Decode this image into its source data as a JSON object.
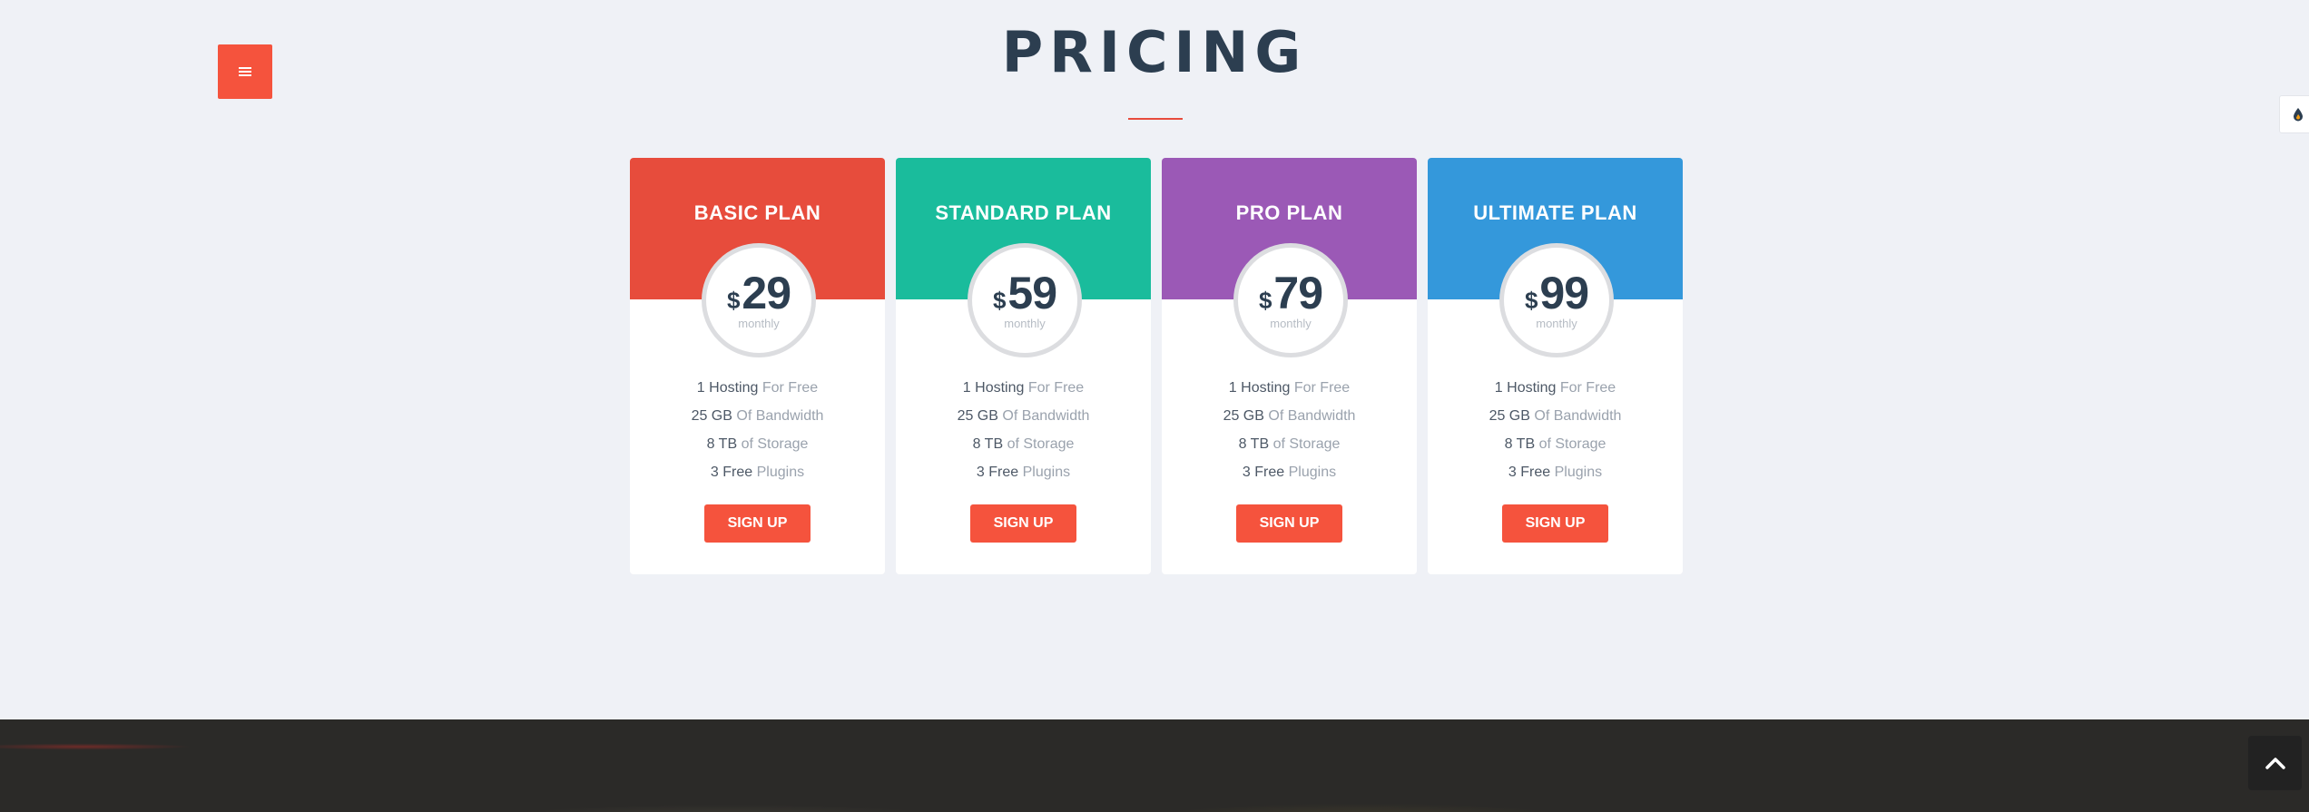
{
  "header": {
    "title": "PRICING",
    "menu_icon": "hamburger-icon",
    "accent_color": "#e74c3c"
  },
  "plans": [
    {
      "name": "BASIC PLAN",
      "currency": "$",
      "price": "29",
      "period": "monthly",
      "color": "#e74c3c",
      "features": [
        {
          "strong": "1 Hosting",
          "rest": "For Free"
        },
        {
          "strong": "25 GB",
          "rest": "Of Bandwidth"
        },
        {
          "strong": "8 TB",
          "rest": "of Storage"
        },
        {
          "strong": "3 Free",
          "rest": "Plugins"
        }
      ],
      "button": "SIGN UP"
    },
    {
      "name": "STANDARD PLAN",
      "currency": "$",
      "price": "59",
      "period": "monthly",
      "color": "#1abc9c",
      "features": [
        {
          "strong": "1 Hosting",
          "rest": "For Free"
        },
        {
          "strong": "25 GB",
          "rest": "Of Bandwidth"
        },
        {
          "strong": "8 TB",
          "rest": "of Storage"
        },
        {
          "strong": "3 Free",
          "rest": "Plugins"
        }
      ],
      "button": "SIGN UP"
    },
    {
      "name": "PRO PLAN",
      "currency": "$",
      "price": "79",
      "period": "monthly",
      "color": "#9b59b6",
      "features": [
        {
          "strong": "1 Hosting",
          "rest": "For Free"
        },
        {
          "strong": "25 GB",
          "rest": "Of Bandwidth"
        },
        {
          "strong": "8 TB",
          "rest": "of Storage"
        },
        {
          "strong": "3 Free",
          "rest": "Plugins"
        }
      ],
      "button": "SIGN UP"
    },
    {
      "name": "ULTIMATE PLAN",
      "currency": "$",
      "price": "99",
      "period": "monthly",
      "color": "#3498db",
      "features": [
        {
          "strong": "1 Hosting",
          "rest": "For Free"
        },
        {
          "strong": "25 GB",
          "rest": "Of Bandwidth"
        },
        {
          "strong": "8 TB",
          "rest": "of Storage"
        },
        {
          "strong": "3 Free",
          "rest": "Plugins"
        }
      ],
      "button": "SIGN UP"
    }
  ],
  "widgets": {
    "style_switcher_icon": "drop-icon",
    "back_to_top_icon": "chevron-up-icon"
  },
  "colors": {
    "button": "#f5533d",
    "background": "#eff1f6",
    "text_dark": "#2c3e50"
  }
}
